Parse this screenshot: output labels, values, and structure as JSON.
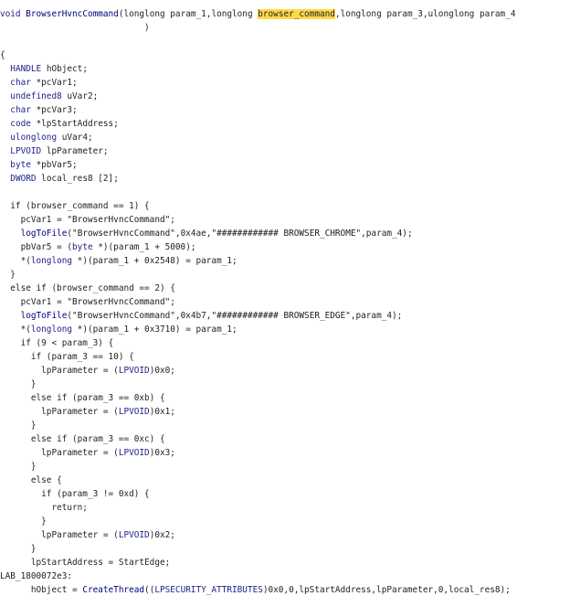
{
  "lines": [
    [
      {
        "t": "void ",
        "c": "type"
      },
      {
        "t": "BrowserHvncCommand",
        "c": "name"
      },
      {
        "t": "(longlong param_1,longlong "
      },
      {
        "t": "browser_command",
        "c": "hl"
      },
      {
        "t": ",longlong param_3,ulonglong param_4"
      }
    ],
    [
      {
        "t": "                            )"
      }
    ],
    [
      {
        "t": ""
      }
    ],
    [
      {
        "t": "{"
      }
    ],
    [
      {
        "t": "  "
      },
      {
        "t": "HANDLE",
        "c": "type"
      },
      {
        "t": " hObject;"
      }
    ],
    [
      {
        "t": "  "
      },
      {
        "t": "char",
        "c": "type"
      },
      {
        "t": " *pcVar1;"
      }
    ],
    [
      {
        "t": "  "
      },
      {
        "t": "undefined8",
        "c": "type"
      },
      {
        "t": " uVar2;"
      }
    ],
    [
      {
        "t": "  "
      },
      {
        "t": "char",
        "c": "type"
      },
      {
        "t": " *pcVar3;"
      }
    ],
    [
      {
        "t": "  "
      },
      {
        "t": "code",
        "c": "type"
      },
      {
        "t": " *lpStartAddress;"
      }
    ],
    [
      {
        "t": "  "
      },
      {
        "t": "ulonglong",
        "c": "type"
      },
      {
        "t": " uVar4;"
      }
    ],
    [
      {
        "t": "  "
      },
      {
        "t": "LPVOID",
        "c": "type"
      },
      {
        "t": " lpParameter;"
      }
    ],
    [
      {
        "t": "  "
      },
      {
        "t": "byte",
        "c": "type"
      },
      {
        "t": " *pbVar5;"
      }
    ],
    [
      {
        "t": "  "
      },
      {
        "t": "DWORD",
        "c": "type"
      },
      {
        "t": " local_res8 [2];"
      }
    ],
    [
      {
        "t": ""
      }
    ],
    [
      {
        "t": "  if (browser_command == 1) {"
      }
    ],
    [
      {
        "t": "    pcVar1 = "
      },
      {
        "t": "\"BrowserHvncCommand\"",
        "c": "str"
      },
      {
        "t": ";"
      }
    ],
    [
      {
        "t": "    "
      },
      {
        "t": "logToFile",
        "c": "name"
      },
      {
        "t": "("
      },
      {
        "t": "\"BrowserHvncCommand\"",
        "c": "str"
      },
      {
        "t": ",0x4ae,"
      },
      {
        "t": "\"############ BROWSER_CHROME\"",
        "c": "str"
      },
      {
        "t": ",param_4);"
      }
    ],
    [
      {
        "t": "    pbVar5 = ("
      },
      {
        "t": "byte",
        "c": "type"
      },
      {
        "t": " *)(param_1 + 5000);"
      }
    ],
    [
      {
        "t": "    *("
      },
      {
        "t": "longlong",
        "c": "type"
      },
      {
        "t": " *)(param_1 + 0x2548) = param_1;"
      }
    ],
    [
      {
        "t": "  }"
      }
    ],
    [
      {
        "t": "  else if (browser_command == 2) {"
      }
    ],
    [
      {
        "t": "    pcVar1 = "
      },
      {
        "t": "\"BrowserHvncCommand\"",
        "c": "str"
      },
      {
        "t": ";"
      }
    ],
    [
      {
        "t": "    "
      },
      {
        "t": "logToFile",
        "c": "name"
      },
      {
        "t": "("
      },
      {
        "t": "\"BrowserHvncCommand\"",
        "c": "str"
      },
      {
        "t": ",0x4b7,"
      },
      {
        "t": "\"############ BROWSER_EDGE\"",
        "c": "str"
      },
      {
        "t": ",param_4);"
      }
    ],
    [
      {
        "t": "    *("
      },
      {
        "t": "longlong",
        "c": "type"
      },
      {
        "t": " *)(param_1 + 0x3710) = param_1;"
      }
    ],
    [
      {
        "t": "    if (9 < param_3) {"
      }
    ],
    [
      {
        "t": "      if (param_3 == 10) {"
      }
    ],
    [
      {
        "t": "        lpParameter = ("
      },
      {
        "t": "LPVOID",
        "c": "type"
      },
      {
        "t": ")0x0;"
      }
    ],
    [
      {
        "t": "      }"
      }
    ],
    [
      {
        "t": "      else if (param_3 == 0xb) {"
      }
    ],
    [
      {
        "t": "        lpParameter = ("
      },
      {
        "t": "LPVOID",
        "c": "type"
      },
      {
        "t": ")0x1;"
      }
    ],
    [
      {
        "t": "      }"
      }
    ],
    [
      {
        "t": "      else if (param_3 == 0xc) {"
      }
    ],
    [
      {
        "t": "        lpParameter = ("
      },
      {
        "t": "LPVOID",
        "c": "type"
      },
      {
        "t": ")0x3;"
      }
    ],
    [
      {
        "t": "      }"
      }
    ],
    [
      {
        "t": "      else {"
      }
    ],
    [
      {
        "t": "        if (param_3 != 0xd) {"
      }
    ],
    [
      {
        "t": "          return;"
      }
    ],
    [
      {
        "t": "        }"
      }
    ],
    [
      {
        "t": "        lpParameter = ("
      },
      {
        "t": "LPVOID",
        "c": "type"
      },
      {
        "t": ")0x2;"
      }
    ],
    [
      {
        "t": "      }"
      }
    ],
    [
      {
        "t": "      lpStartAddress = StartEdge;"
      }
    ],
    [
      {
        "t": "LAB_1800072e3:"
      }
    ],
    [
      {
        "t": "      hObject = "
      },
      {
        "t": "CreateThread",
        "c": "name"
      },
      {
        "t": "(("
      },
      {
        "t": "LPSECURITY_ATTRIBUTES",
        "c": "type"
      },
      {
        "t": ")0x0,0,lpStartAddress,lpParameter,0,local_res8);"
      }
    ]
  ],
  "tops": [
    9,
    24,
    39,
    54,
    69,
    84,
    99,
    114,
    129,
    144,
    159,
    174,
    189,
    204,
    219,
    234,
    249,
    264,
    279,
    294,
    309,
    324,
    339,
    354,
    369,
    384,
    399,
    414,
    429,
    444,
    459,
    474,
    489,
    504,
    519,
    534,
    549,
    564,
    579,
    594,
    609,
    624,
    639
  ],
  "lefts": [
    0,
    0,
    0,
    0,
    0,
    0,
    0,
    0,
    0,
    0,
    0,
    0,
    0,
    0,
    0,
    0,
    0,
    0,
    0,
    0,
    0,
    0,
    0,
    0,
    0,
    0,
    0,
    0,
    0,
    0,
    0,
    0,
    0,
    0,
    0,
    0,
    0,
    0,
    0,
    0,
    0,
    0,
    0
  ]
}
